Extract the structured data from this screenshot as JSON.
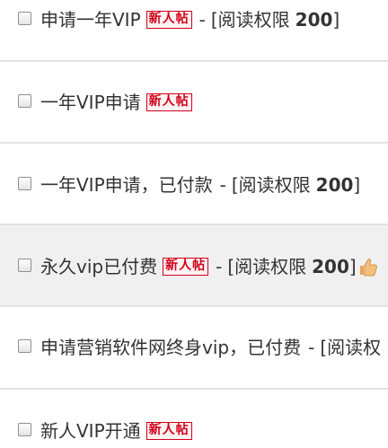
{
  "threads": [
    {
      "title": "申请一年VIP",
      "badge": "新人帖",
      "separator": "-",
      "permission_text": "[阅读权限",
      "permission_value": "200",
      "permission_close": "]"
    },
    {
      "title": "一年VIP申请",
      "badge": "新人帖"
    },
    {
      "title": "一年VIP申请，已付款",
      "separator": "-",
      "permission_text": "[阅读权限",
      "permission_value": "200",
      "permission_close": "]"
    },
    {
      "title": "永久vip已付费",
      "badge": "新人帖",
      "separator": "-",
      "permission_text": "[阅读权限",
      "permission_value": "200",
      "permission_close": "]",
      "icon": "thumbs-up-icon"
    },
    {
      "title": "申请营销软件网终身vip，已付费",
      "separator": "-",
      "permission_text": "[阅读权"
    },
    {
      "title": "新人VIP开通",
      "badge": "新人帖"
    }
  ],
  "colors": {
    "badge_red": "#d0021b",
    "row_highlight": "#f0f0f0",
    "divider": "#e2e2e2",
    "text": "#333333"
  }
}
